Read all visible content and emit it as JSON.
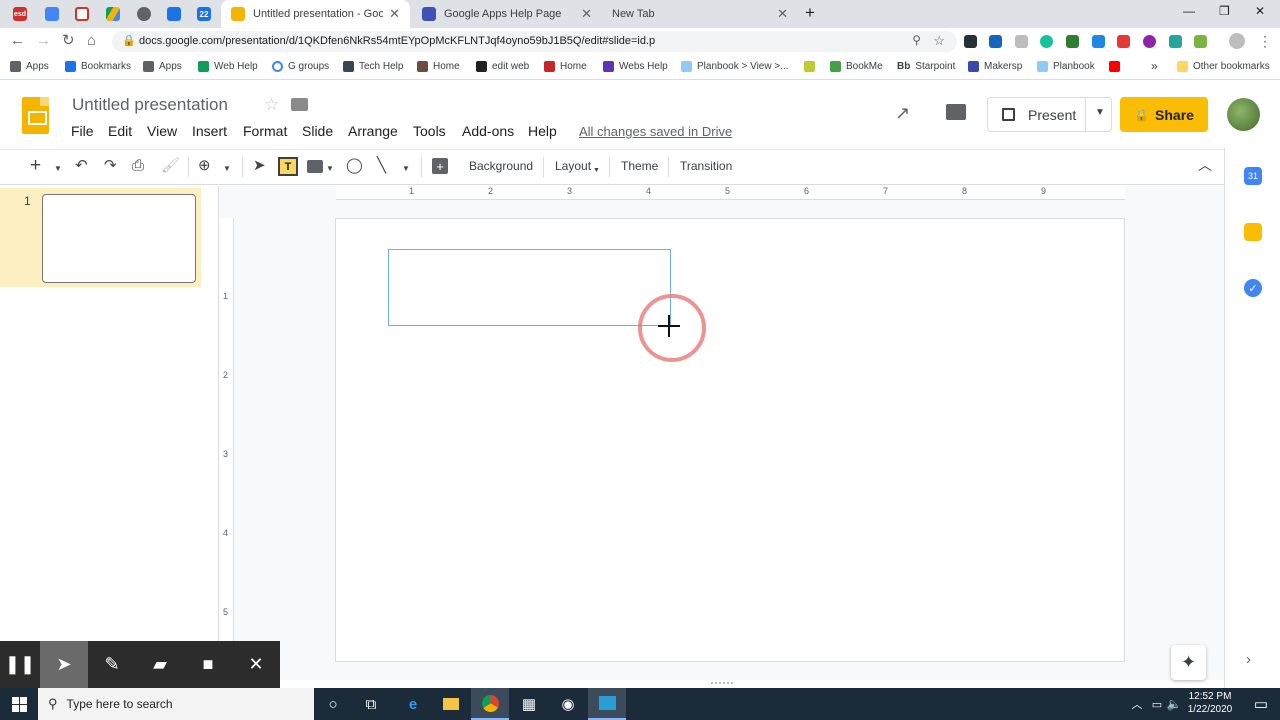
{
  "browser": {
    "tabs": [
      {
        "title": "Untitled presentation - Google Sl",
        "active": true
      },
      {
        "title": "Google Apps Help Page",
        "active": false
      },
      {
        "title": "New Tab",
        "active": false
      }
    ],
    "pinned_tabs": [
      "esd",
      "docs",
      "gmail",
      "drive",
      "chrome",
      "shield",
      "calendar 22"
    ],
    "url": "docs.google.com/presentation/d/1QKDfen6NkRs54mtEYpOpMcKFLNTJqf4oyno59bJ1B5Q/edit#slide=id.p",
    "bookmarks": [
      "Apps",
      "Bookmarks",
      "Apps",
      "Web Help",
      "G groups",
      "Tech Help",
      "Home",
      "edit web",
      "Home",
      "Webs Help",
      "Planbook > View >...",
      "",
      "BookMe",
      "Starpoint",
      "Makersp",
      "Planbook",
      "",
      "Other bookmarks"
    ]
  },
  "slides": {
    "title": "Untitled presentation",
    "menus": [
      "File",
      "Edit",
      "View",
      "Insert",
      "Format",
      "Slide",
      "Arrange",
      "Tools",
      "Add-ons",
      "Help"
    ],
    "saved_status": "All changes saved in Drive",
    "present_label": "Present",
    "share_label": "Share",
    "toolbar_text": {
      "background": "Background",
      "layout": "Layout",
      "theme": "Theme",
      "transition": "Transition"
    },
    "slide_number": "1",
    "ruler_h": [
      "1",
      "2",
      "3",
      "4",
      "5",
      "6",
      "7",
      "8",
      "9"
    ],
    "ruler_v": [
      "1",
      "2",
      "3",
      "4",
      "5"
    ]
  },
  "taskbar": {
    "search_placeholder": "Type here to search",
    "time": "12:52 PM",
    "date": "1/22/2020"
  },
  "colors": {
    "slides_yellow": "#f4b400",
    "share_button": "#fbbc04",
    "selection_highlight": "#feefc3",
    "textbox_border": "#6fb3d4",
    "click_ring": "#e86e6e",
    "taskbar": "#1c2b3a"
  }
}
